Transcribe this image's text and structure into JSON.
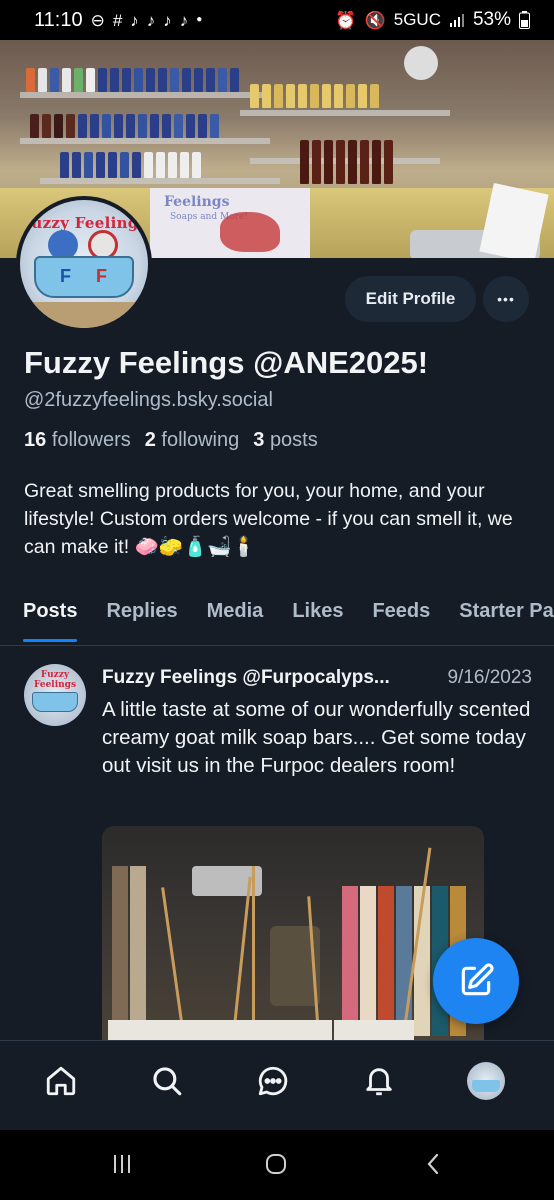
{
  "status_bar": {
    "time": "11:10",
    "network": "5GUC",
    "battery": "53%",
    "left_icons": [
      "minus-circle-icon",
      "slack-icon",
      "tiktok-icon",
      "tiktok-icon",
      "tiktok-icon",
      "tiktok-icon",
      "dot-icon"
    ],
    "right_icons": [
      "alarm-icon",
      "mute-icon",
      "signal-icon",
      "battery-icon"
    ]
  },
  "profile": {
    "display_name": "Fuzzy Feelings @ANE2025!",
    "handle": "@2fuzzyfeelings.bsky.social",
    "avatar_text": "Fuzzy Feelings",
    "banner_sign": "Feelings",
    "banner_sign_sub": "Soaps and More!",
    "stats": {
      "followers_count": "16",
      "followers_label": "followers",
      "following_count": "2",
      "following_label": "following",
      "posts_count": "3",
      "posts_label": "posts"
    },
    "bio": "Great smelling products for you, your home, and your lifestyle! Custom orders welcome - if you can smell it, we can make it! 🧼🧽🧴🛁🕯️",
    "edit_button": "Edit Profile",
    "more_button": "•••"
  },
  "tabs": [
    {
      "label": "Posts",
      "active": true
    },
    {
      "label": "Replies",
      "active": false
    },
    {
      "label": "Media",
      "active": false
    },
    {
      "label": "Likes",
      "active": false
    },
    {
      "label": "Feeds",
      "active": false
    },
    {
      "label": "Starter Packs",
      "active": false
    }
  ],
  "post": {
    "author": "Fuzzy Feelings @Furpocalyps...",
    "date": "9/16/2023",
    "text": "A little taste at some of our wonderfully scented creamy goat milk soap bars.... Get some today out visit us in the Furpoc dealers room!",
    "avatar_text": "Fuzzy Feelings"
  },
  "fab_icon": "compose-icon",
  "bottom_nav": [
    "home-icon",
    "search-icon",
    "chat-icon",
    "bell-icon",
    "profile-avatar"
  ],
  "system_nav": [
    "recents-icon",
    "home-circle-icon",
    "back-icon"
  ],
  "colors": {
    "background": "#151c26",
    "accent": "#1083fe",
    "fab": "#1d84f2",
    "muted_text": "#aebbc9",
    "button_bg": "#1e2937"
  }
}
